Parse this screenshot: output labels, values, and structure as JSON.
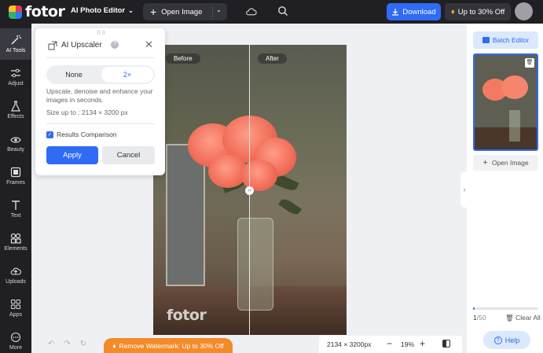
{
  "header": {
    "logo_text": "fotor",
    "app_switch": "AI Photo Editor",
    "open_image": "Open Image",
    "download": "Download",
    "promo": "Up to 30% Off"
  },
  "sidebar": {
    "items": [
      {
        "label": "AI Tools",
        "icon": "magic-wand-icon"
      },
      {
        "label": "Adjust",
        "icon": "sliders-icon"
      },
      {
        "label": "Effects",
        "icon": "flask-icon"
      },
      {
        "label": "Beauty",
        "icon": "eye-icon"
      },
      {
        "label": "Frames",
        "icon": "frame-icon"
      },
      {
        "label": "Text",
        "icon": "text-icon"
      },
      {
        "label": "Elements",
        "icon": "shapes-icon"
      },
      {
        "label": "Uploads",
        "icon": "upload-icon"
      },
      {
        "label": "Apps",
        "icon": "apps-icon"
      },
      {
        "label": "More",
        "icon": "more-icon"
      }
    ]
  },
  "upscaler": {
    "title": "AI Upscaler",
    "options": [
      "None",
      "2×"
    ],
    "selected": "2×",
    "description": "Upscale, denoise and enhance your images in seconds.",
    "size_limit": "Size up to : 2134 × 3200 px",
    "results_comparison": "Results Comparison",
    "results_comparison_checked": true,
    "apply": "Apply",
    "cancel": "Cancel"
  },
  "canvas": {
    "before_label": "Before",
    "after_label": "After",
    "watermark": "fotor"
  },
  "bottom": {
    "remove_watermark": "Remove Watermark: Up to 30% Off",
    "dimensions": "2134 × 3200px",
    "zoom": "19%"
  },
  "right_panel": {
    "batch_editor": "Batch Editor",
    "open_image": "Open Image",
    "count_current": "1",
    "count_total": "/50",
    "clear_all": "Clear All",
    "help": "Help"
  },
  "colors": {
    "accent": "#2f6bf5",
    "dark_bg": "#1f1f24",
    "promo_orange": "#f28b2a"
  }
}
